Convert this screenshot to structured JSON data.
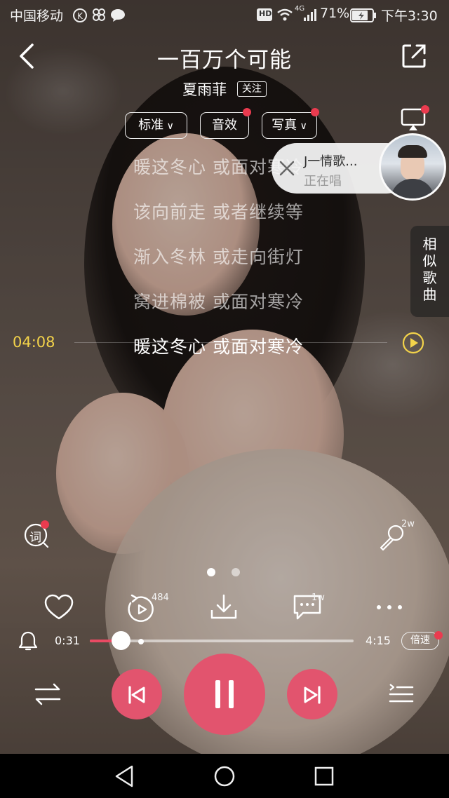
{
  "status_bar": {
    "carrier": "中国移动",
    "network": "4G",
    "battery": "71%",
    "time": "下午3:30",
    "hd_label": "HD"
  },
  "header": {
    "title": "一百万个可能",
    "artist": "夏雨菲",
    "follow_label": "关注"
  },
  "options": {
    "quality_label": "标准",
    "effects_label": "音效",
    "photo_label": "写真"
  },
  "floating_card": {
    "name": "J一情歌...",
    "status": "正在唱"
  },
  "lyrics": {
    "lines": [
      "暖这冬心 或面对寒冷",
      "该向前走 或者继续等",
      "渐入冬林 或走向街灯",
      "窝进棉被 或面对寒冷",
      "暖这冬心 或面对寒冷"
    ],
    "current_index": 4,
    "seek_time": "04:08"
  },
  "side_tab": {
    "label_chars": [
      "相",
      "似",
      "歌",
      "曲"
    ]
  },
  "tools": {
    "lyric_icon_label": "词",
    "sing_count": "2w",
    "loop_count": "484",
    "comment_count": "1w"
  },
  "page_indicator": {
    "count": 2,
    "active": 0
  },
  "playback": {
    "elapsed": "0:31",
    "total": "4:15",
    "progress_fraction": 0.121,
    "speed_label": "倍速",
    "state": "playing"
  },
  "colors": {
    "accent": "#e2546e",
    "seek_time": "#f3d34a",
    "badge": "#ea3b4f",
    "progress_fill": "#ea4a63"
  }
}
